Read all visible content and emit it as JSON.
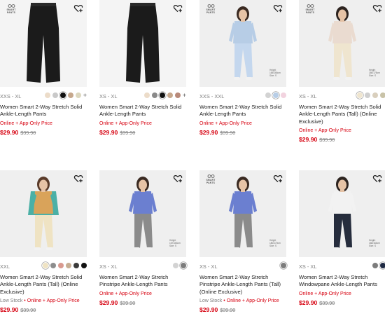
{
  "brand_mark_text": [
    "SMART",
    "PANTS"
  ],
  "products": [
    {
      "size_range": "XXS - XL",
      "name": "Women Smart 2-Way Stretch Solid Ankle-Length Pants",
      "stock_note": "",
      "availability": "Online + App-Only Price",
      "price": "$29.90",
      "original_price": "$39.90",
      "has_brand_mark": true,
      "height_note": "",
      "swatch_colors": [
        "#ecdcc9",
        "#c9c9c9",
        "#111111",
        "#c6a88d",
        "#dcd7bf"
      ],
      "selected_swatch": 2,
      "more_colors_label": "+"
    },
    {
      "size_range": "XS - XL",
      "name": "Women Smart 2-Way Stretch Solid Ankle-Length Pants",
      "stock_note": "",
      "availability": "Online + App-Only Price",
      "price": "$29.90",
      "original_price": "$39.90",
      "has_brand_mark": false,
      "height_note": "",
      "swatch_colors": [
        "#ecdcc9",
        "#8a8a8a",
        "#111111",
        "#c6a88d",
        "#b98a7a"
      ],
      "selected_swatch": 2,
      "more_colors_label": "+"
    },
    {
      "size_range": "XXS - XXL",
      "name": "Women Smart 2-Way Stretch Solid Ankle-Length Pants",
      "stock_note": "",
      "availability": "Online + App-Only Price",
      "price": "$29.90",
      "original_price": "$39.90",
      "has_brand_mark": true,
      "height_note": "Height 165/166cm\nSize: S",
      "swatch_colors": [
        "#d3d3d3",
        "#b7cde6",
        "#f2d3df"
      ],
      "selected_swatch": 1,
      "more_colors_label": ""
    },
    {
      "size_range": "XS - XL",
      "name": "Women Smart 2-Way Stretch Solid Ankle-Length Pants (Tall) (Online Exclusive)",
      "stock_note": "",
      "availability": "Online + App-Only Price",
      "price": "$29.90",
      "original_price": "$39.90",
      "has_brand_mark": true,
      "height_note": "Height 180/175cm\nSize: S",
      "swatch_colors": [
        "#efe5cf",
        "#cfcfcf",
        "#d9cfbd",
        "#c9c3a8"
      ],
      "selected_swatch": 0,
      "more_colors_label": ""
    },
    {
      "size_range": "XXL",
      "name": "Women Smart 2-Way Stretch Solid Ankle-Length Pants (Tall) (Online Exclusive)",
      "stock_note": "Low Stock",
      "availability": "Online + App-Only Price",
      "price": "$29.90",
      "original_price": "$39.90",
      "has_brand_mark": false,
      "height_note": "",
      "swatch_colors": [
        "#efe3c3",
        "#8d8d8d",
        "#d99a8f",
        "#c6ae93",
        "#3b3b3b",
        "#111111"
      ],
      "selected_swatch": 0,
      "more_colors_label": ""
    },
    {
      "size_range": "XS - XL",
      "name": "Women Smart 2-Way Stretch Pinstripe Ankle-Length Pants",
      "stock_note": "",
      "availability": "Online + App-Only Price",
      "price": "$29.90",
      "original_price": "$39.90",
      "has_brand_mark": false,
      "height_note": "Height 167/164cm\nSize: S",
      "swatch_colors": [
        "#d3d3d3",
        "#7c7c7c"
      ],
      "selected_swatch": 1,
      "more_colors_label": ""
    },
    {
      "size_range": "XS - XL",
      "name": "Women Smart 2-Way Stretch Pinstripe Ankle-Length Pants (Tall) (Online Exclusive)",
      "stock_note": "Low Stock",
      "availability": "Online + App-Only Price",
      "price": "$29.90",
      "original_price": "$39.90",
      "has_brand_mark": true,
      "height_note": "Height 180/170cm\nSize: S",
      "swatch_colors": [
        "#7c7c7c"
      ],
      "selected_swatch": 0,
      "more_colors_label": ""
    },
    {
      "size_range": "XS - XL",
      "name": "Women Smart 2-Way Stretch Windowpane Ankle-Length Pants",
      "stock_note": "",
      "availability": "Online + App-Only Price",
      "price": "$29.90",
      "original_price": "$39.90",
      "has_brand_mark": false,
      "height_note": "Height 168/164cm\nSize: S",
      "swatch_colors": [
        "#7c7c7c",
        "#1f2a44"
      ],
      "selected_swatch": 1,
      "more_colors_label": ""
    }
  ],
  "colors": {
    "sale_red": "#d6000f",
    "muted": "#7d7d7d",
    "card_bg": "#f4f4f4"
  },
  "icons": {
    "favorite": "heart-plus-icon",
    "brand": "smart-pants-logo-icon"
  }
}
